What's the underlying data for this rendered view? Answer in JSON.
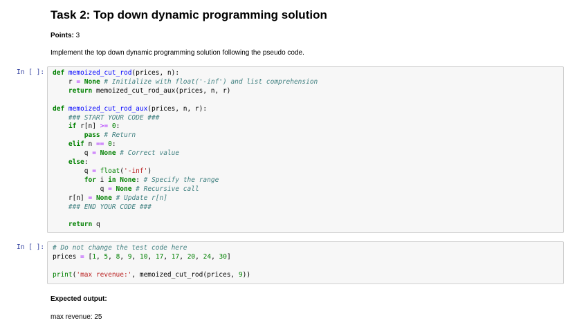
{
  "task": {
    "title": "Task 2: Top down dynamic programming solution",
    "points_label": "Points:",
    "points_value": "3",
    "description": "Implement the top down dynamic programming solution following the pseudo code."
  },
  "cells": [
    {
      "prompt": "In [ ]:",
      "lines": [
        "def memoized_cut_rod(prices, n):",
        "    r = None # Initialize with float('-inf') and list comprehension",
        "    return memoized_cut_rod_aux(prices, n, r)",
        "",
        "def memoized_cut_rod_aux(prices, n, r):",
        "    ### START YOUR CODE ###",
        "    if r[n] >= 0:",
        "        pass # Return",
        "    elif n == 0:",
        "        q = None # Correct value",
        "    else:",
        "        q = float('-inf')",
        "        for i in None: # Specify the range",
        "            q = None # Recursive call",
        "    r[n] = None # Update r[n]",
        "    ### END YOUR CODE ###",
        "",
        "    return q"
      ]
    },
    {
      "prompt": "In [ ]:",
      "lines": [
        "# Do not change the test code here",
        "prices = [1, 5, 8, 9, 10, 17, 17, 20, 24, 30]",
        "",
        "print('max revenue:', memoized_cut_rod(prices, 9))"
      ]
    }
  ],
  "output": {
    "expected_label": "Expected output:",
    "result": "max revenue: 25"
  }
}
